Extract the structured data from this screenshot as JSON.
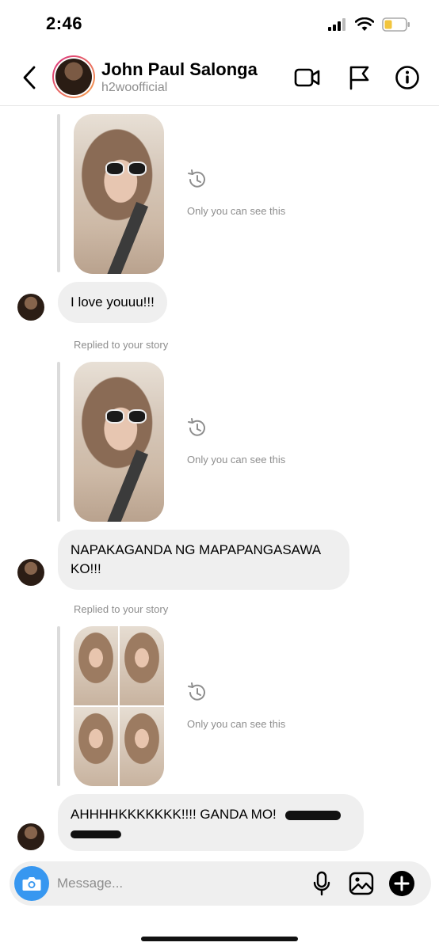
{
  "status_bar": {
    "time": "2:46"
  },
  "header": {
    "name": "John Paul Salonga",
    "username": "h2woofficial"
  },
  "chat": {
    "only_you_label": "Only you can see this",
    "replied_label": "Replied to your story",
    "messages": [
      {
        "text": "I love youuu!!!"
      },
      {
        "text": "NAPAKAGANDA NG MAPAPANGASAWA KO!!!"
      },
      {
        "text": "AHHHHKKKKKKK!!!! GANDA MO!"
      }
    ]
  },
  "composer": {
    "placeholder": "Message..."
  },
  "colors": {
    "accent": "#3797f0",
    "bubble": "#efefef",
    "muted": "#8e8e8e"
  }
}
